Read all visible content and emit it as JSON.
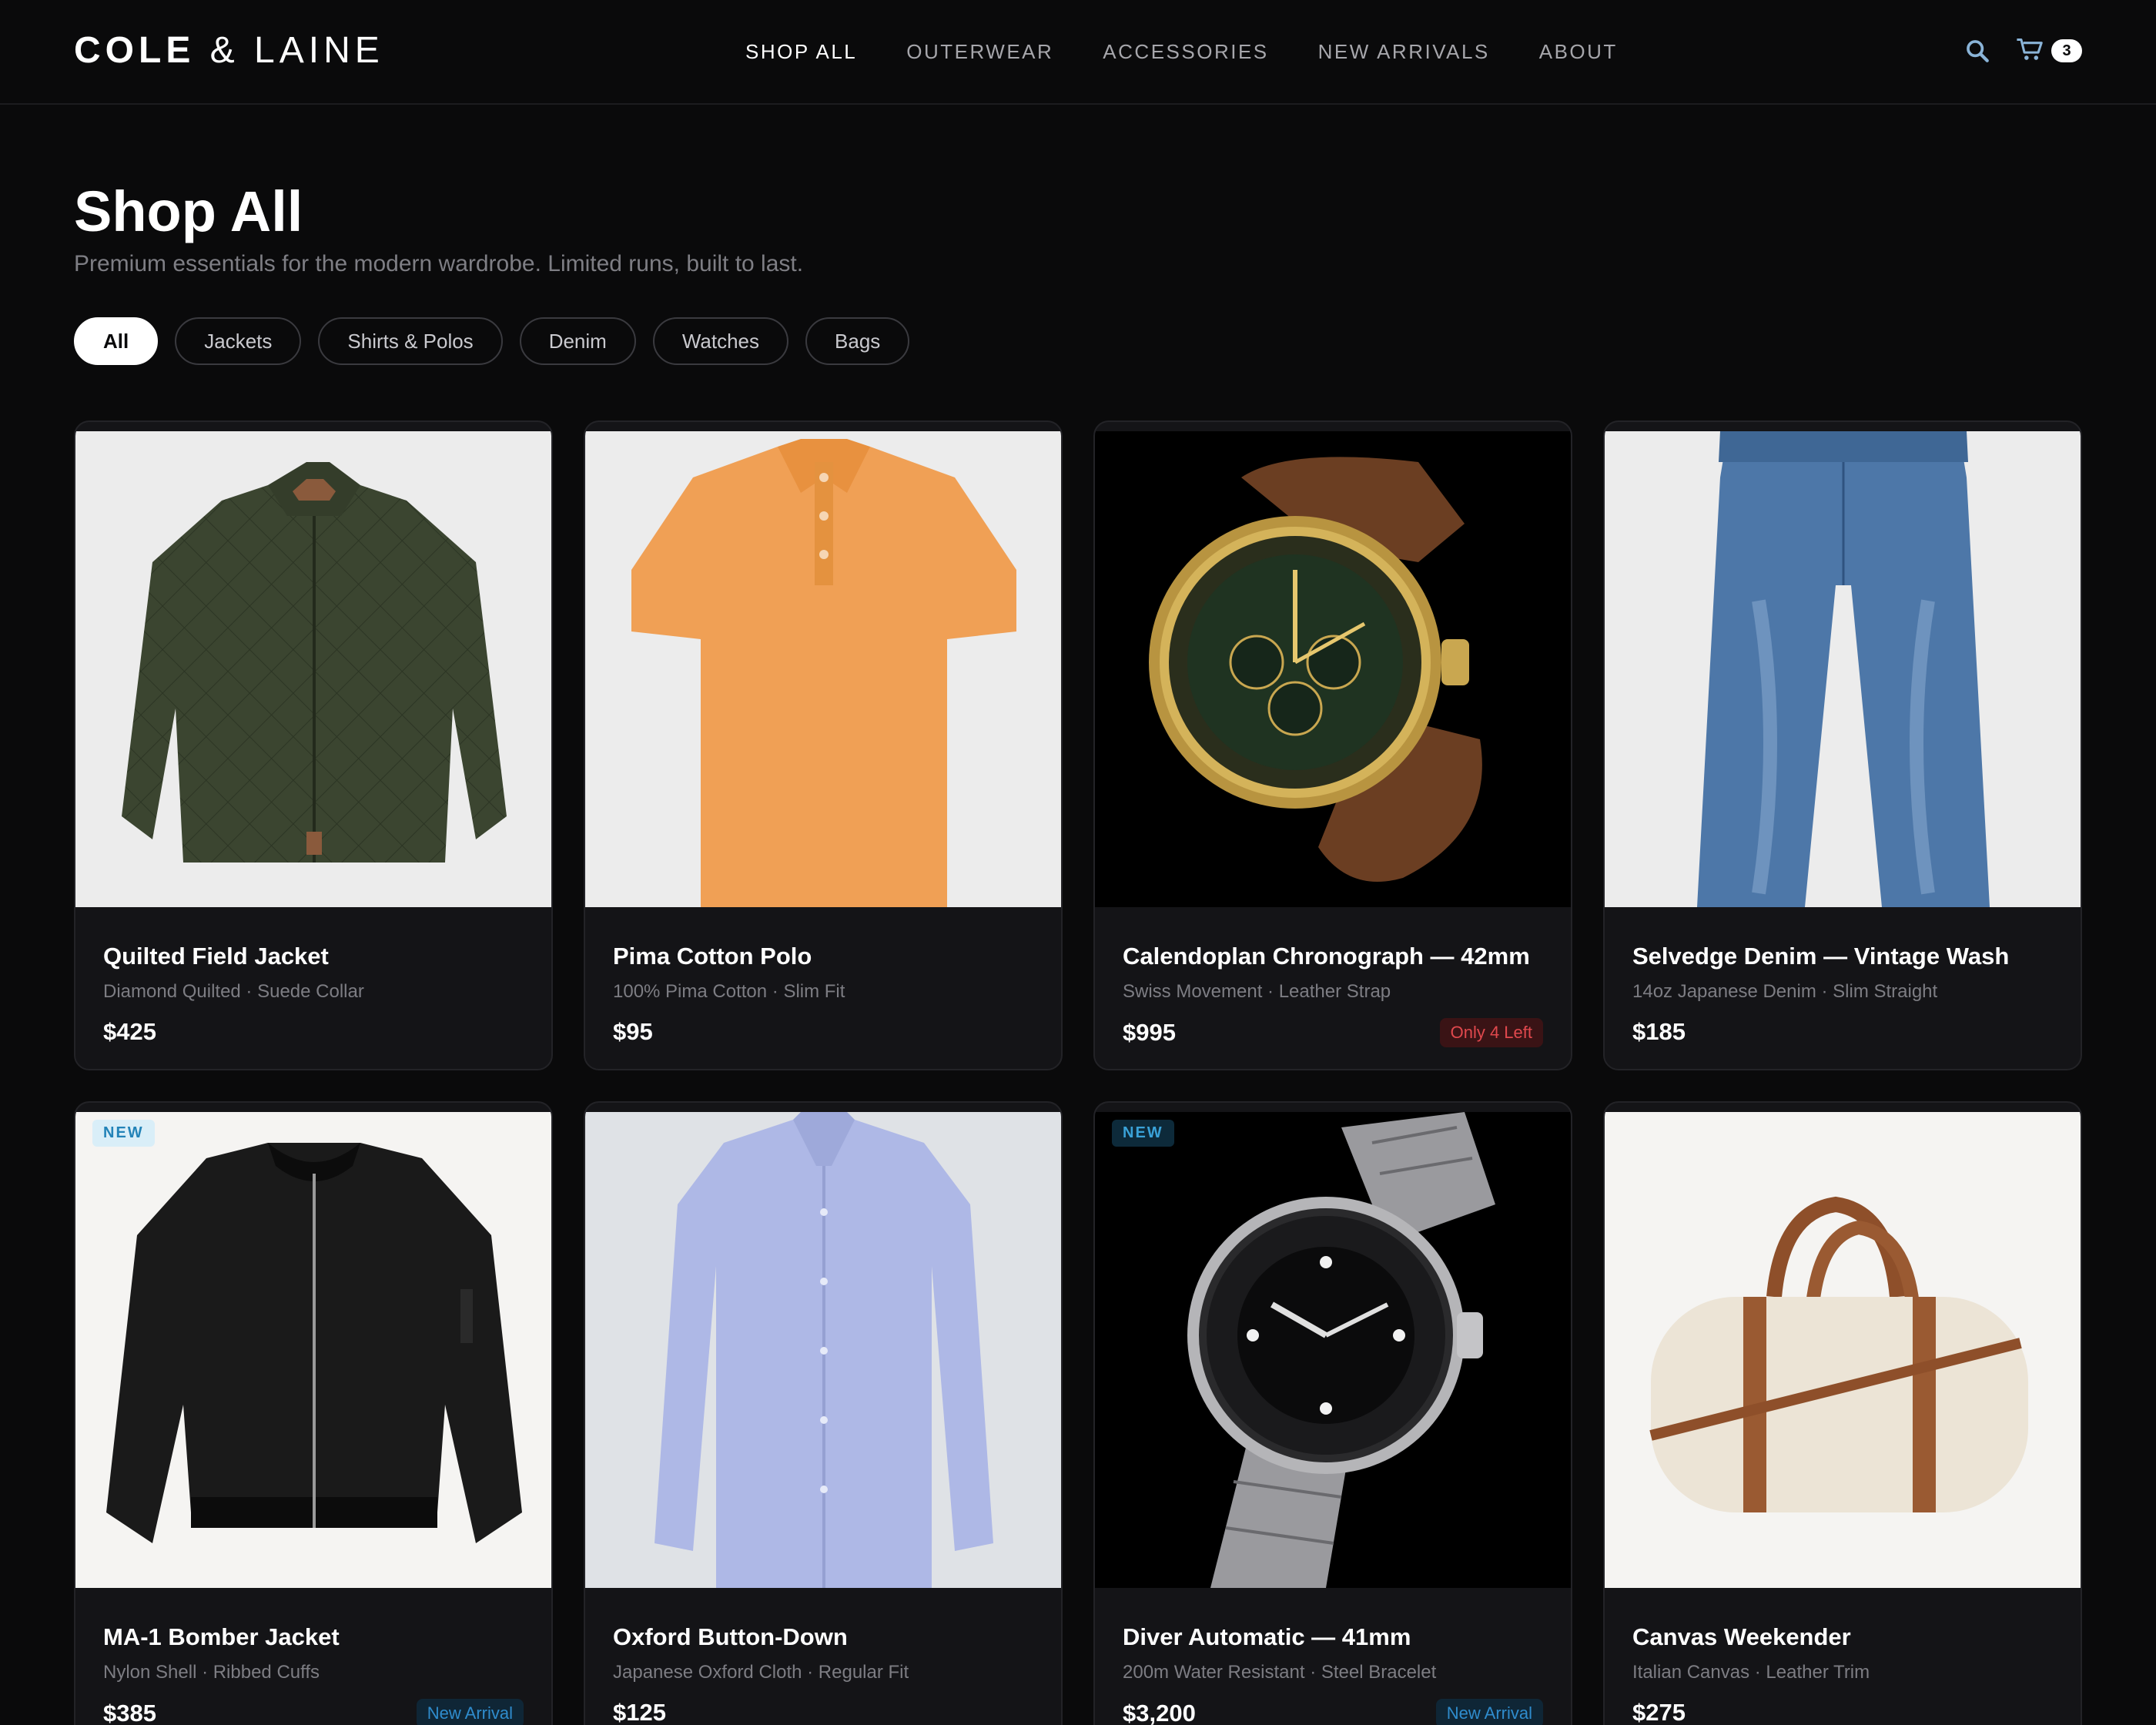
{
  "brand": {
    "part1": "COLE",
    "part2": " & LAINE"
  },
  "nav": {
    "items": [
      {
        "label": "SHOP ALL",
        "active": true
      },
      {
        "label": "OUTERWEAR",
        "active": false
      },
      {
        "label": "ACCESSORIES",
        "active": false
      },
      {
        "label": "NEW ARRIVALS",
        "active": false
      },
      {
        "label": "ABOUT",
        "active": false
      }
    ],
    "cart_count": "3",
    "icons": [
      "search-icon",
      "cart-icon"
    ]
  },
  "header": {
    "title": "Shop All",
    "subtitle": "Premium essentials for the modern wardrobe. Limited runs, built to last."
  },
  "filters": [
    "All",
    "Jackets",
    "Shirts & Polos",
    "Denim",
    "Watches",
    "Bags"
  ],
  "products": [
    {
      "name": "Quilted Field Jacket",
      "desc": "Diamond Quilted · Suede Collar",
      "price": "$425",
      "tag": "",
      "pill": "",
      "image": "quilted-jacket"
    },
    {
      "name": "Pima Cotton Polo",
      "desc": "100% Pima Cotton · Slim Fit",
      "price": "$95",
      "tag": "",
      "pill": "",
      "image": "orange-polo"
    },
    {
      "name": "Calendoplan Chronograph — 42mm",
      "desc": "Swiss Movement · Leather Strap",
      "price": "$995",
      "tag": "",
      "pill": "Only 4 Left",
      "image": "gold-chronograph"
    },
    {
      "name": "Selvedge Denim — Vintage Wash",
      "desc": "14oz Japanese Denim · Slim Straight",
      "price": "$185",
      "tag": "",
      "pill": "",
      "image": "selvedge-jeans"
    },
    {
      "name": "MA-1 Bomber Jacket",
      "desc": "Nylon Shell · Ribbed Cuffs",
      "price": "$385",
      "tag": "NEW",
      "pill": "New Arrival",
      "image": "bomber-jacket"
    },
    {
      "name": "Oxford Button-Down",
      "desc": "Japanese Oxford Cloth · Regular Fit",
      "price": "$125",
      "tag": "",
      "pill": "",
      "image": "oxford-shirt"
    },
    {
      "name": "Diver Automatic — 41mm",
      "desc": "200m Water Resistant · Steel Bracelet",
      "price": "$3,200",
      "tag": "NEW",
      "pill": "New Arrival",
      "image": "diver-watch"
    },
    {
      "name": "Canvas Weekender",
      "desc": "Italian Canvas · Leather Trim",
      "price": "$275",
      "tag": "",
      "pill": "",
      "image": "canvas-bag"
    }
  ],
  "colors": {
    "background": "#0a0a0b",
    "card": "#141417",
    "accent_red": "#e0484d",
    "accent_blue": "#2f8ccd"
  }
}
